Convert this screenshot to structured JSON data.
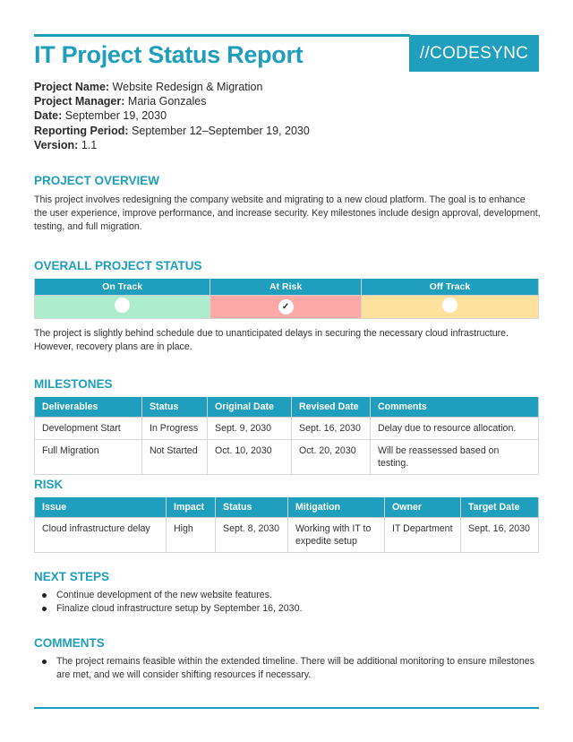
{
  "header": {
    "title": "IT Project Status Report",
    "logo_text": "//CODESYNC"
  },
  "meta": [
    {
      "label": "Project Name:",
      "value": "Website Redesign & Migration"
    },
    {
      "label": "Project Manager:",
      "value": "Maria Gonzales"
    },
    {
      "label": "Date:",
      "value": "September 19, 2030"
    },
    {
      "label": "Reporting Period:",
      "value": "September 12–September 19, 2030"
    },
    {
      "label": "Version:",
      "value": "1.1"
    }
  ],
  "overview": {
    "heading": "PROJECT OVERVIEW",
    "text": "This project involves redesigning the company website and migrating to a new cloud platform. The goal is to enhance the user experience, improve performance, and increase security. Key milestones include design approval, development, testing, and full migration."
  },
  "status": {
    "heading": "OVERALL PROJECT STATUS",
    "columns": [
      "On Track",
      "At Risk",
      "Off Track"
    ],
    "selected": "At Risk",
    "check_glyph": "✓",
    "colors": {
      "on_track": "#aeecce",
      "at_risk": "#ffa8a8",
      "off_track": "#fde19c"
    },
    "note": "The project is slightly behind schedule due to unanticipated delays in securing the necessary cloud infrastructure. However, recovery plans are in place."
  },
  "milestones": {
    "heading": "MILESTONES",
    "columns": [
      "Deliverables",
      "Status",
      "Original Date",
      "Revised Date",
      "Comments"
    ],
    "rows": [
      [
        "Development Start",
        "In Progress",
        "Sept. 9, 2030",
        "Sept. 16, 2030",
        "Delay due to resource allocation."
      ],
      [
        "Full Migration",
        "Not Started",
        "Oct. 10, 2030",
        "Oct. 20, 2030",
        "Will be reassessed based on testing."
      ]
    ]
  },
  "risk": {
    "heading": "RISK",
    "columns": [
      "Issue",
      "Impact",
      "Status",
      "Mitigation",
      "Owner",
      "Target Date"
    ],
    "rows": [
      [
        "Cloud infrastructure delay",
        "High",
        "Sept. 8, 2030",
        "Working with IT to expedite setup",
        "IT Department",
        "Sept. 16, 2030"
      ]
    ]
  },
  "next_steps": {
    "heading": "NEXT STEPS",
    "items": [
      "Continue development of the new website features.",
      "Finalize cloud infrastructure setup by September 16, 2030."
    ]
  },
  "comments": {
    "heading": "COMMENTS",
    "items": [
      "The project remains feasible within the extended timeline. There will be additional monitoring to ensure milestones are met, and we will consider shifting resources if necessary."
    ]
  },
  "theme": {
    "accent": "#1e9ebb"
  }
}
